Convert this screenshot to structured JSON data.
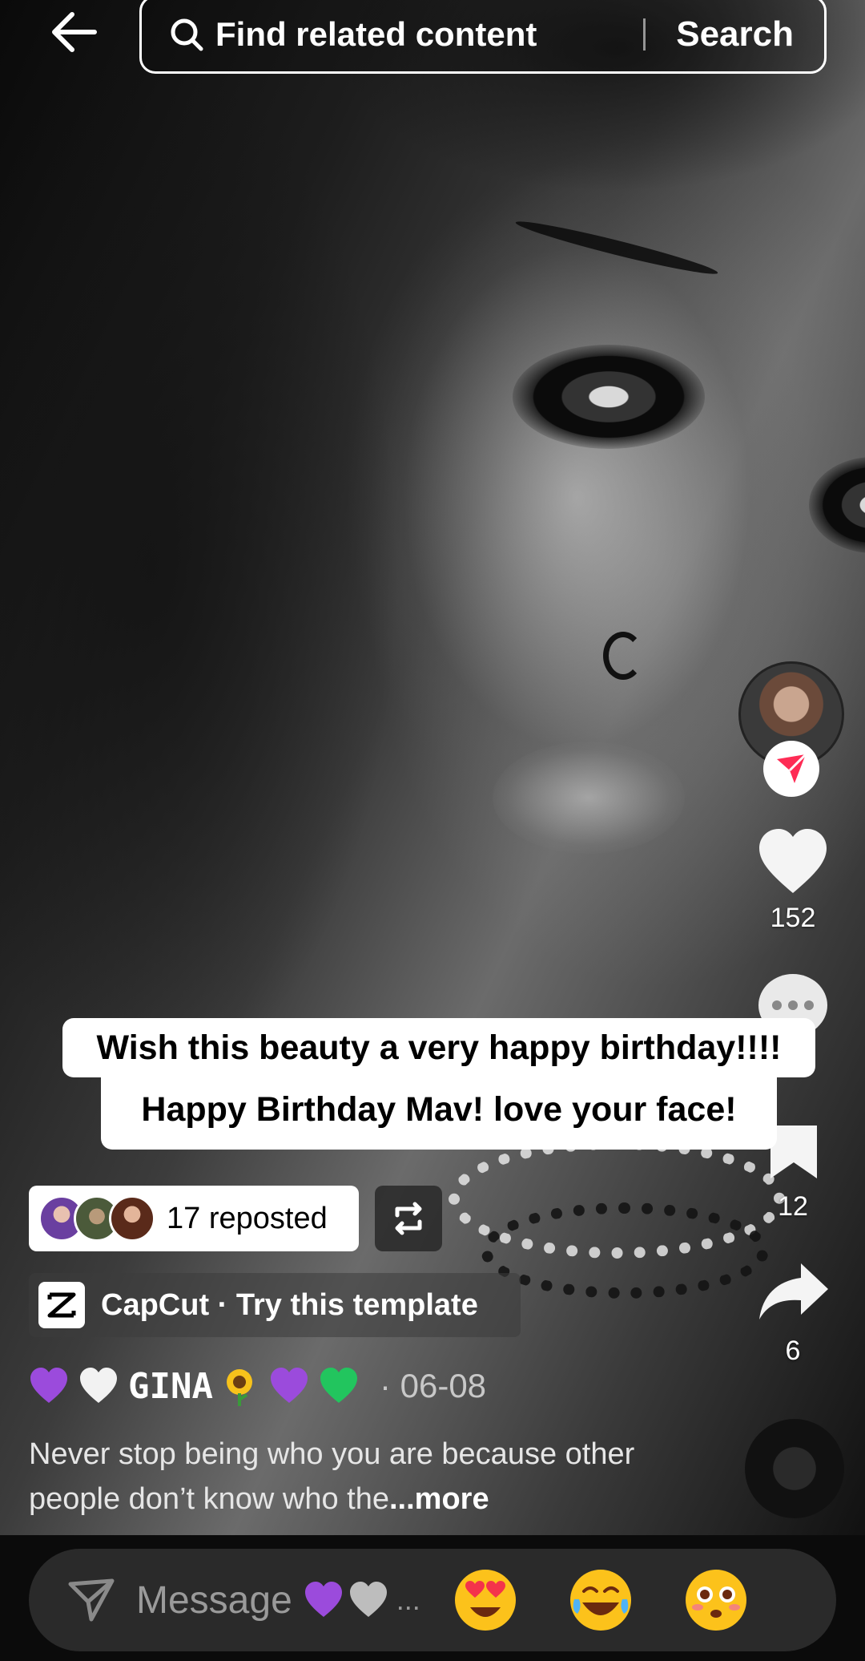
{
  "search": {
    "placeholder": "Find related content",
    "button_label": "Search"
  },
  "video": {
    "caption_line_1": "Wish this beauty a very happy birthday!!!!",
    "caption_line_2": "Happy Birthday Mav! love your face!"
  },
  "actions": {
    "like_count": "152",
    "save_count": "12",
    "share_count": "6"
  },
  "repost": {
    "text": "17 reposted"
  },
  "template": {
    "text": "CapCut · Try this template"
  },
  "author": {
    "name": "GINA",
    "date": "· 06-08",
    "emojis": [
      "purple-heart",
      "white-heart",
      "sunflower",
      "purple-heart",
      "green-heart"
    ]
  },
  "description": {
    "text": "Never stop being who you are because other people don’t know who the",
    "more": "...more"
  },
  "message": {
    "placeholder": "Message",
    "ellipsis": "...",
    "quick_emojis": [
      "heart-eyes",
      "tears-of-joy",
      "flushed"
    ]
  },
  "colors": {
    "purple_heart": "#9b4bdc",
    "green_heart": "#22c55e",
    "follow_red": "#fe2c55"
  }
}
